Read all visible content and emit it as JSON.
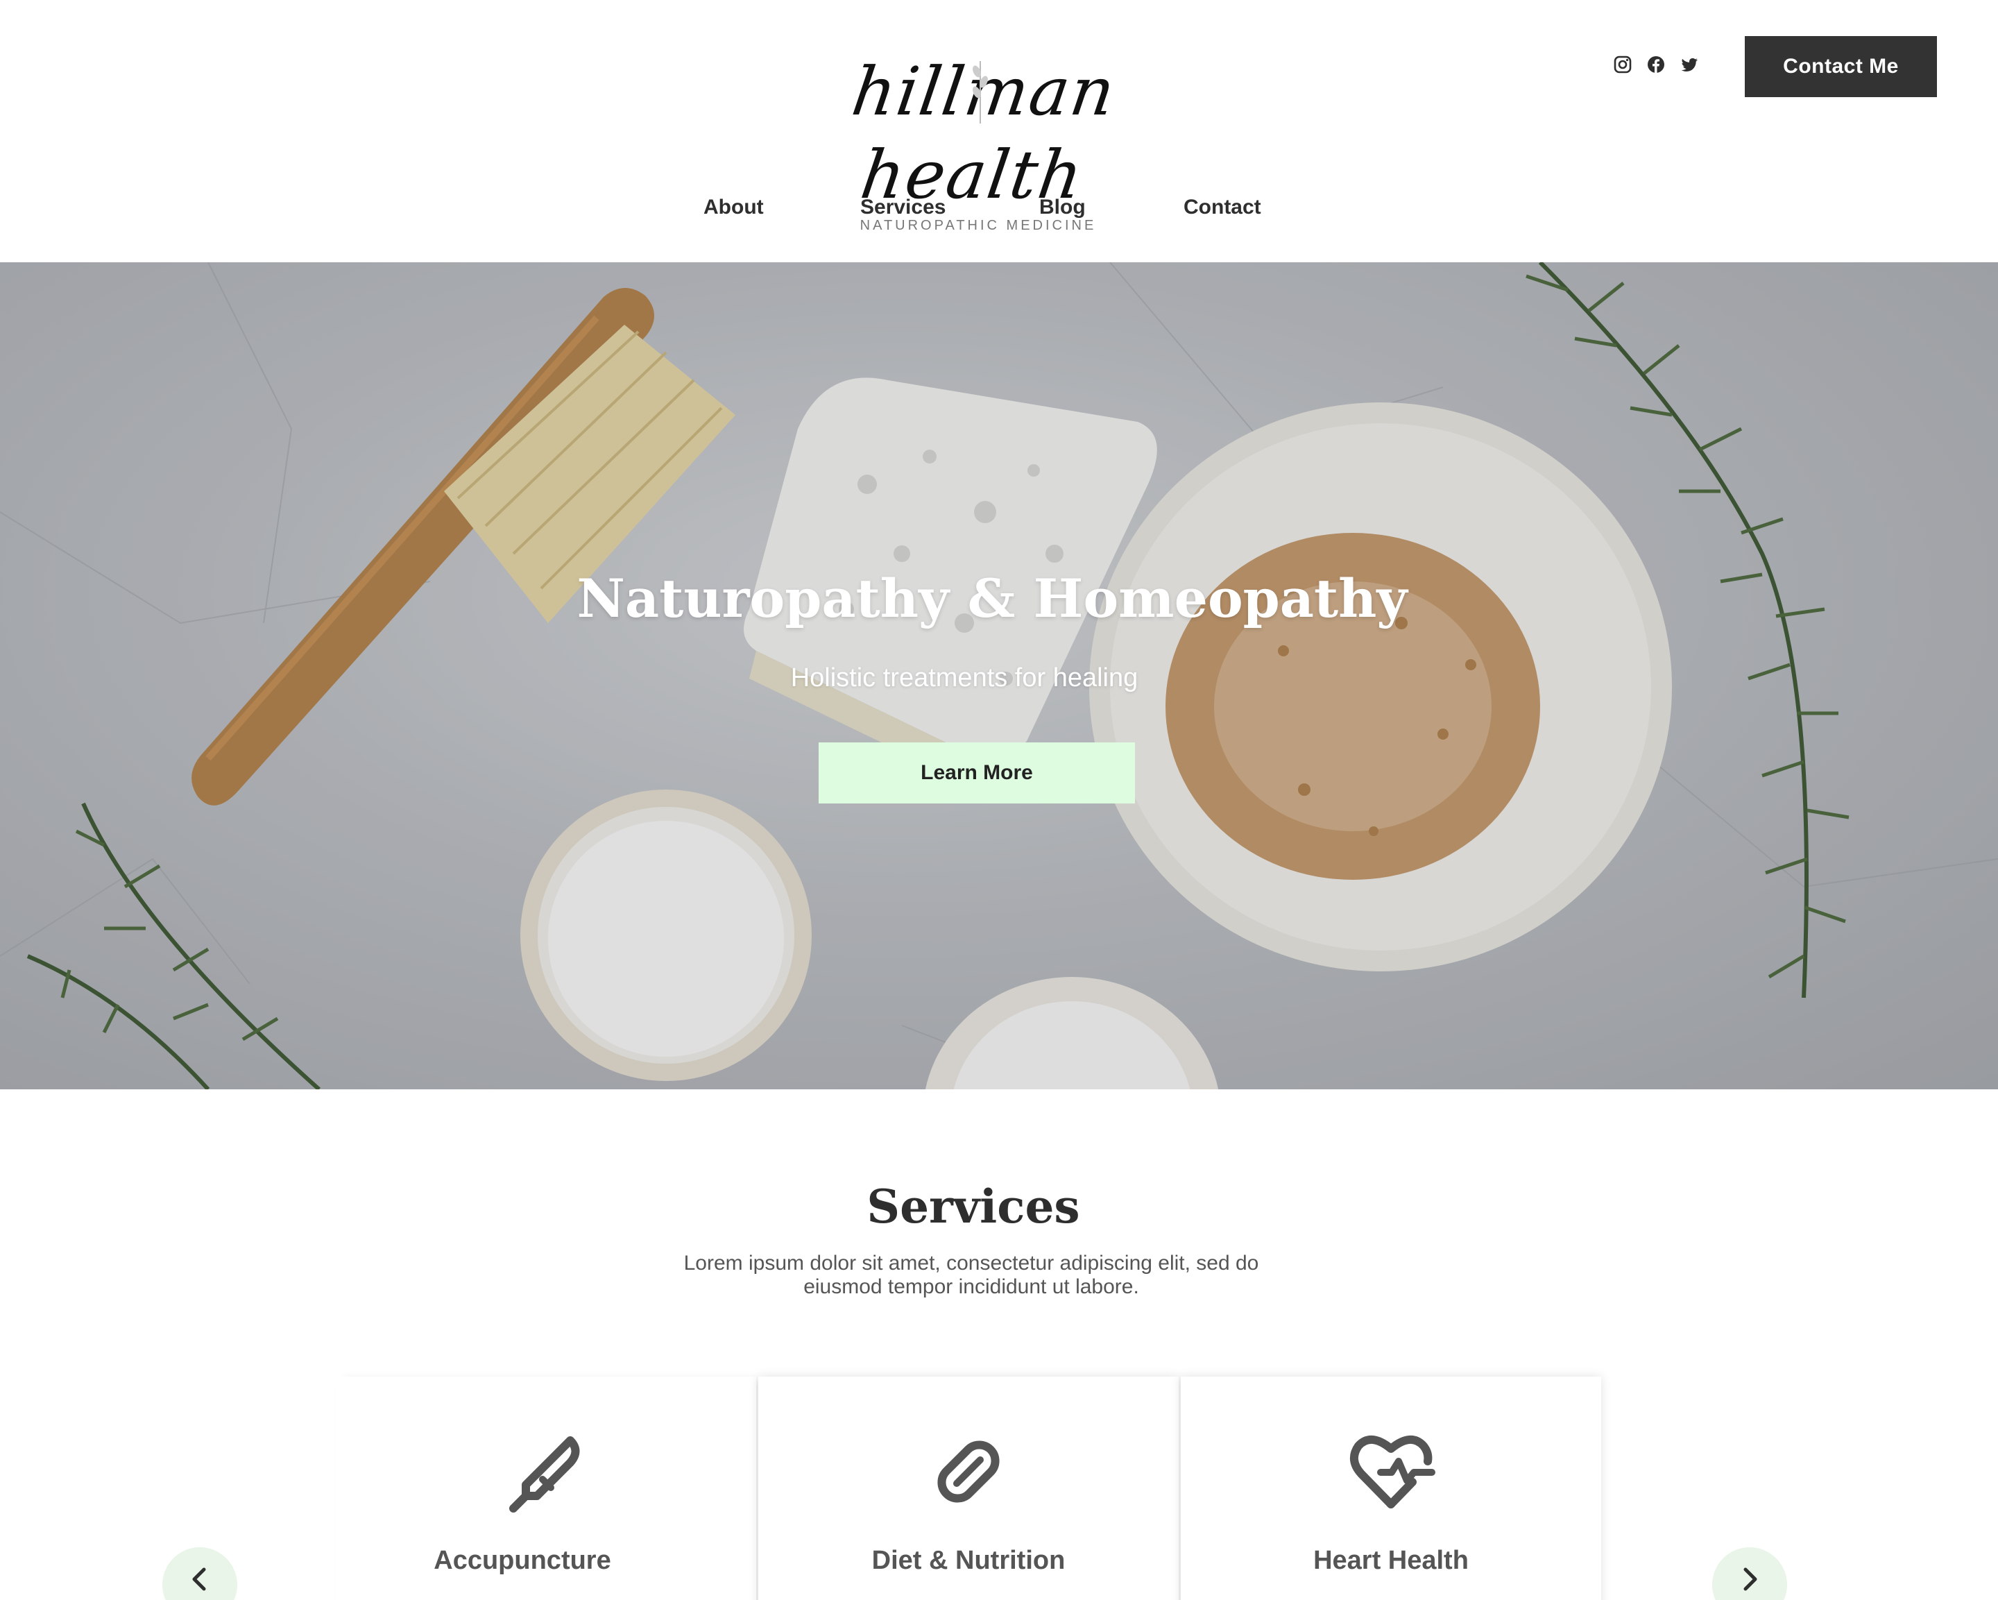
{
  "brand": {
    "name": "hillman health",
    "tagline": "NATUROPATHIC MEDICINE"
  },
  "header": {
    "social_icons": [
      "instagram-icon",
      "facebook-icon",
      "twitter-icon"
    ],
    "contact_button": "Contact Me"
  },
  "nav": {
    "items": [
      {
        "label": "About"
      },
      {
        "label": "Services"
      },
      {
        "label": "Blog"
      },
      {
        "label": "Contact"
      }
    ]
  },
  "hero": {
    "title": "Naturopathy & Homeopathy",
    "subtitle": "Holistic treatments for healing",
    "cta": "Learn More"
  },
  "services": {
    "title": "Services",
    "description": "Lorem ipsum dolor sit amet, consectetur adipiscing elit, sed do eiusmod tempor incididunt ut labore.",
    "cards": [
      {
        "label": "Accupuncture",
        "icon": "thermometer-icon"
      },
      {
        "label": "Diet & Nutrition",
        "icon": "pill-icon"
      },
      {
        "label": "Heart Health",
        "icon": "heart-pulse-icon"
      }
    ]
  },
  "colors": {
    "dark_button": "#333333",
    "accent_green": "#defcdf",
    "arrow_bg": "#e8f5e8",
    "text": "#2e2e2e"
  }
}
